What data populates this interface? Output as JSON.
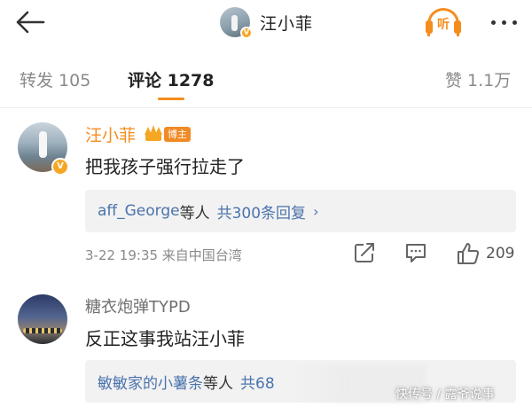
{
  "header": {
    "title": "汪小菲",
    "listen_label": "听",
    "back_icon": "arrow-left-icon",
    "more_icon": "more-dots-icon",
    "accent_color": "#f58d1e"
  },
  "tabs": [
    {
      "label": "转发 105",
      "active": false
    },
    {
      "label": "评论 1278",
      "active": true
    },
    {
      "label": "赞 1.1万",
      "active": false
    }
  ],
  "comments": [
    {
      "author": "汪小菲",
      "author_tag": "博主",
      "verified": true,
      "text": "把我孩子强行拉走了",
      "replies": {
        "users": "aff_George",
        "suffix": "等人",
        "count": "共300条回复",
        "chevron": "›"
      },
      "time_location": "3-22 19:35 来自中国台湾",
      "likes": "209"
    },
    {
      "author": "糖衣炮弹TYPD",
      "text": "反正这事我站汪小菲",
      "replies": {
        "users": "敏敏家的小薯条",
        "suffix": "等人",
        "count": "共68"
      }
    }
  ],
  "watermark": "快传号 / 露爷说事"
}
